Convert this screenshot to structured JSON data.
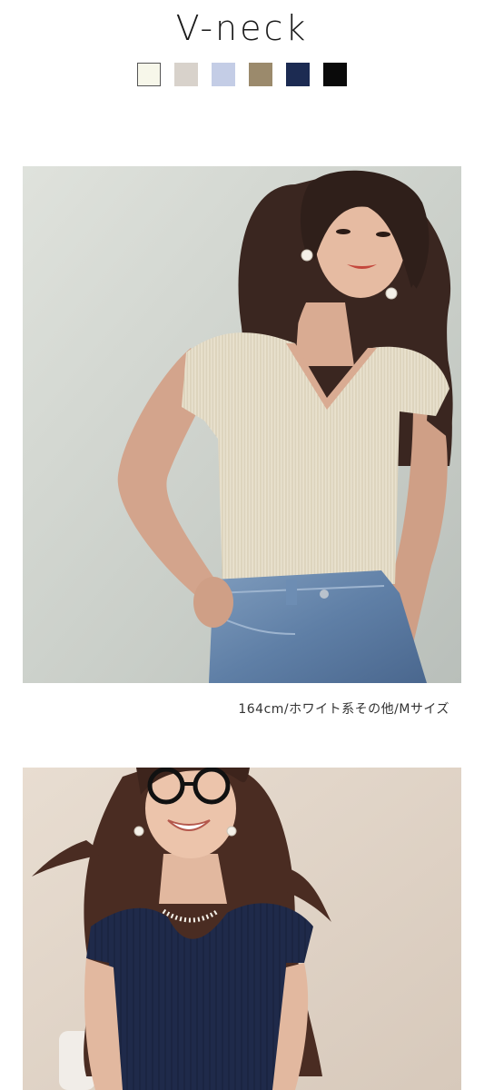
{
  "header": {
    "title": "V-neck"
  },
  "color_options": [
    {
      "name": "white-swatch",
      "color": "#f7f7ea",
      "border": "#555555"
    },
    {
      "name": "greige-swatch",
      "color": "#d8d2cb",
      "border": "#d8d2cb"
    },
    {
      "name": "light-blue-swatch",
      "color": "#c4cde6",
      "border": "#c4cde6"
    },
    {
      "name": "khaki-swatch",
      "color": "#9b8a6c",
      "border": "#9b8a6c"
    },
    {
      "name": "navy-swatch",
      "color": "#1c2b52",
      "border": "#1c2b52"
    },
    {
      "name": "black-swatch",
      "color": "#0a0a0a",
      "border": "#0a0a0a"
    }
  ],
  "products": [
    {
      "image": "model-wearing-ivory-ribbed-vneck-top-and-jeans",
      "caption": "164cm/ホワイト系その他/Mサイズ"
    },
    {
      "image": "model-wearing-navy-ribbed-top-with-glasses"
    }
  ]
}
